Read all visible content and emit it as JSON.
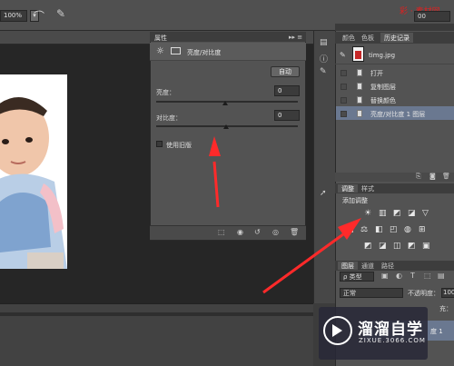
{
  "options_bar": {
    "zoom_value": "100%",
    "zoom_arrow": "▾",
    "tool_icon_1": "lasso-icon",
    "tool_icon_2": "brush-icon",
    "brand_text": "彩 · 素材网",
    "right_value": "00"
  },
  "properties": {
    "tab_title": "属性",
    "collapse": "▸▸ ≡",
    "adjustment_icon": "sun-icon",
    "adjustment_name": "亮度/对比度",
    "auto_button": "自动",
    "brightness_label": "亮度：",
    "brightness_value": "0",
    "contrast_label": "对比度：",
    "contrast_value": "0",
    "legacy_label": "使用旧版"
  },
  "history": {
    "tabs": [
      "颜色",
      "色板",
      "历史记录"
    ],
    "active_tab": 2,
    "snapshot_name": "timg.jpg",
    "items": [
      "打开",
      "复制图层",
      "替换颜色",
      "亮度/对比度 1 图层"
    ],
    "selected_index": 3
  },
  "adjustments": {
    "tabs": [
      "调整",
      "样式"
    ],
    "add_label": "添加调整",
    "row1_icons": [
      "☀",
      "▥",
      "◩",
      "◪",
      "▽"
    ],
    "row2_icons": [
      "▦",
      "⚖",
      "◧",
      "◰",
      "◍",
      "⊞"
    ],
    "row3_icons": [
      "◩",
      "◪",
      "◫",
      "◩",
      "▣"
    ]
  },
  "layers": {
    "tabs": [
      "图层",
      "通道",
      "路径"
    ],
    "kind_select": "ρ 类型",
    "blend_mode": "正常",
    "opacity_label": "不透明度：",
    "opacity_value": "100",
    "fill_label": "充：",
    "layer_name": "度 1"
  },
  "watermark": {
    "name": "溜溜自学",
    "url": "ZIXUE.3066.COM"
  },
  "colors": {
    "panel": "#535353",
    "selected": "#6a7890",
    "arrow": "#ff2a2a"
  }
}
